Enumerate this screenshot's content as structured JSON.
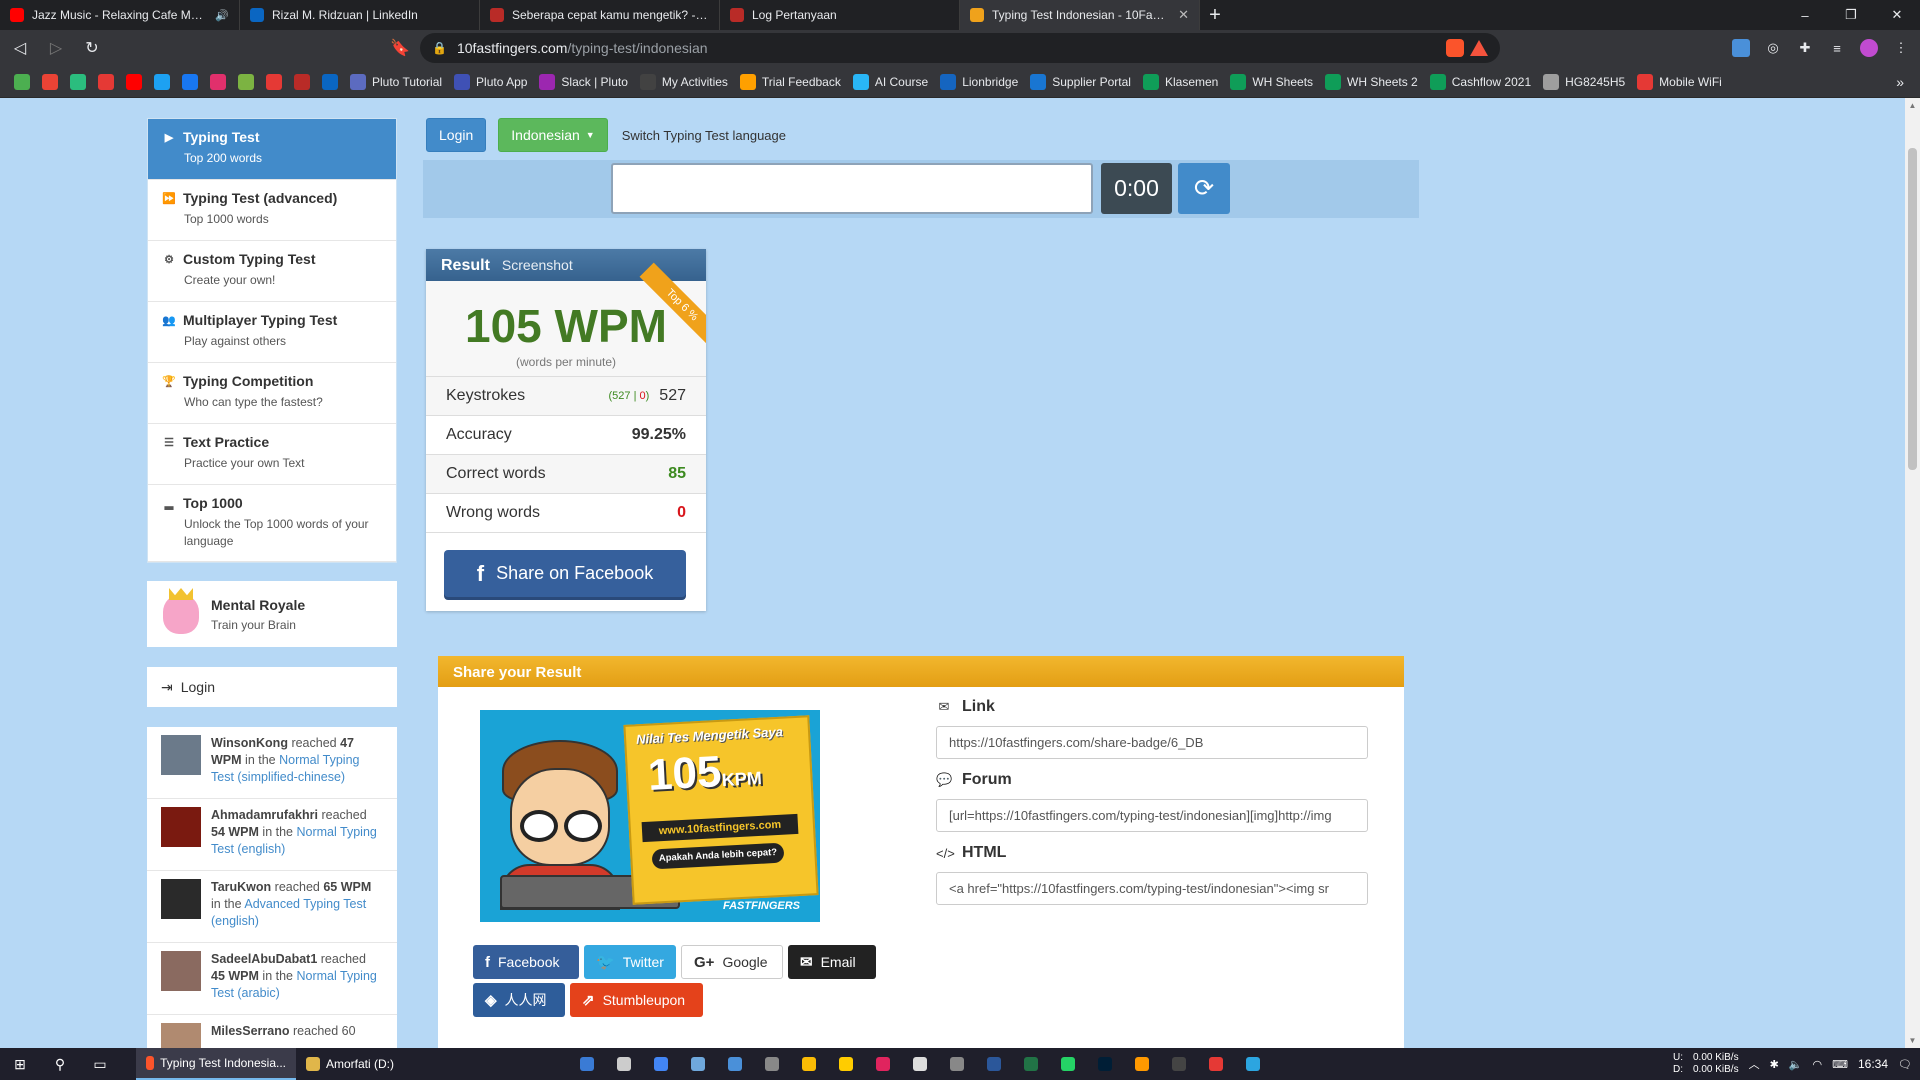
{
  "browser": {
    "tabs": [
      {
        "title": "Jazz Music - Relaxing Cafe Music -",
        "favicon_color": "#ff0000",
        "audio_icon": "speaker-icon"
      },
      {
        "title": "Rizal M. Ridzuan | LinkedIn",
        "favicon_color": "#0a66c2"
      },
      {
        "title": "Seberapa cepat kamu mengetik? - Qu",
        "favicon_color": "#b92b27"
      },
      {
        "title": "Log Pertanyaan",
        "favicon_color": "#b92b27"
      },
      {
        "title": "Typing Test Indonesian - 10FastFin",
        "favicon_color": "#f0a21b",
        "active": true
      }
    ],
    "url_host": "10fastfingers.com",
    "url_path": "/typing-test/indonesian",
    "bookmarks": [
      {
        "label": "",
        "color": "#4caf50"
      },
      {
        "label": "",
        "color": "#ea4335"
      },
      {
        "label": "",
        "color": "#2bbd7e"
      },
      {
        "label": "",
        "color": "#e53935"
      },
      {
        "label": "",
        "color": "#ff0000"
      },
      {
        "label": "",
        "color": "#1da1f2"
      },
      {
        "label": "",
        "color": "#1877f2"
      },
      {
        "label": "",
        "color": "#e1306c"
      },
      {
        "label": "",
        "color": "#7cb342"
      },
      {
        "label": "",
        "color": "#e53935"
      },
      {
        "label": "",
        "color": "#b92b27"
      },
      {
        "label": "",
        "color": "#0a66c2"
      },
      {
        "label": "Pluto Tutorial",
        "color": "#5c6bc0"
      },
      {
        "label": "Pluto App",
        "color": "#3f51b5"
      },
      {
        "label": "Slack | Pluto",
        "color": "#9c27b0"
      },
      {
        "label": "My Activities",
        "color": "#424242"
      },
      {
        "label": "Trial Feedback",
        "color": "#ffa000"
      },
      {
        "label": "AI Course",
        "color": "#29b6f6"
      },
      {
        "label": "Lionbridge",
        "color": "#1565c0"
      },
      {
        "label": "Supplier Portal",
        "color": "#1976d2"
      },
      {
        "label": "Klasemen",
        "color": "#0f9d58"
      },
      {
        "label": "WH Sheets",
        "color": "#0f9d58"
      },
      {
        "label": "WH Sheets 2",
        "color": "#0f9d58"
      },
      {
        "label": "Cashflow 2021",
        "color": "#0f9d58"
      },
      {
        "label": "HG8245H5",
        "color": "#9e9e9e"
      },
      {
        "label": "Mobile WiFi",
        "color": "#e53935"
      }
    ]
  },
  "sidebar": {
    "items": [
      {
        "title": "Typing Test",
        "sub": "Top 200 words",
        "icon": "play-icon",
        "glyph": "▶"
      },
      {
        "title": "Typing Test (advanced)",
        "sub": "Top 1000 words",
        "icon": "fast-forward-icon",
        "glyph": "⏩"
      },
      {
        "title": "Custom Typing Test",
        "sub": "Create your own!",
        "icon": "cogs-icon",
        "glyph": "⚙"
      },
      {
        "title": "Multiplayer Typing Test",
        "sub": "Play against others",
        "icon": "users-icon",
        "glyph": "👥"
      },
      {
        "title": "Typing Competition",
        "sub": "Who can type the fastest?",
        "icon": "trophy-icon",
        "glyph": "🏆"
      },
      {
        "title": "Text Practice",
        "sub": "Practice your own Text",
        "icon": "file-text-icon",
        "glyph": "☰"
      },
      {
        "title": "Top 1000",
        "sub": "Unlock the Top 1000 words of your language",
        "icon": "signal-icon",
        "glyph": "▂"
      }
    ],
    "royale": {
      "title": "Mental Royale",
      "sub": "Train your Brain"
    },
    "login": "Login",
    "feed": [
      {
        "user": "WinsonKong",
        "reached": "reached",
        "wpm": "47 WPM",
        "in_the": "in the",
        "test": "Normal Typing Test (simplified-chinese)",
        "avatar_color": "#6b7a8a"
      },
      {
        "user": "Ahmadamrufakhri",
        "reached": "reached",
        "wpm": "54 WPM",
        "in_the": "in the",
        "test": "Normal Typing Test (english)",
        "avatar_color": "#7a1a10"
      },
      {
        "user": "TaruKwon",
        "reached": "reached",
        "wpm": "65 WPM",
        "in_the": "in the",
        "test": "Advanced Typing Test (english)",
        "avatar_color": "#2a2a2a"
      },
      {
        "user": "SadeelAbuDabat1",
        "reached": "reached",
        "wpm": "45 WPM",
        "in_the": "in the",
        "test": "Normal Typing Test (arabic)",
        "avatar_color": "#8a6a60"
      },
      {
        "user": "MilesSerrano",
        "reached": "reached 60",
        "wpm": "",
        "in_the": "",
        "test": "",
        "avatar_color": "#b08a70"
      }
    ]
  },
  "top": {
    "login": "Login",
    "language": "Indonesian",
    "language_hint": "Switch Typing Test language"
  },
  "typebar": {
    "timer": "0:00",
    "input_value": ""
  },
  "result": {
    "title": "Result",
    "screenshot": "Screenshot",
    "ribbon": "Top 6 %",
    "wpm": "105 WPM",
    "wpm_sub": "(words per minute)",
    "keystrokes_label": "Keystrokes",
    "keystrokes_correct": "527",
    "keystrokes_wrong": "0",
    "keystrokes_total": "527",
    "accuracy_label": "Accuracy",
    "accuracy": "99.25%",
    "correct_label": "Correct words",
    "correct": "85",
    "wrong_label": "Wrong words",
    "wrong": "0",
    "facebook": "Share on Facebook"
  },
  "share": {
    "title": "Share your Result",
    "badge": {
      "title": "Nilai Tes Mengetik Saya",
      "number": "105",
      "unit": "KPM",
      "url": "www.10fastfingers.com",
      "ask": "Apakah Anda lebih cepat?",
      "logo": "FASTFINGERS"
    },
    "buttons": {
      "facebook": "Facebook",
      "twitter": "Twitter",
      "google": "Google",
      "email": "Email",
      "renren": "人人网",
      "stumbleupon": "Stumbleupon"
    },
    "link_label": "Link",
    "link_value": "https://10fastfingers.com/share-badge/6_DB",
    "forum_label": "Forum",
    "forum_value": "[url=https://10fastfingers.com/typing-test/indonesian][img]http://img",
    "html_label": "HTML",
    "html_value": "<a href=\"https://10fastfingers.com/typing-test/indonesian\"><img sr"
  },
  "taskbar": {
    "tasks": [
      {
        "label": "Typing Test Indonesia...",
        "active": true
      },
      {
        "label": "Amorfati (D:)",
        "active": false
      }
    ],
    "apps": [
      "#3a7bd5",
      "#cccccc",
      "#4285f4",
      "#6fa8dc",
      "#4a90d9",
      "#888888",
      "#fbbc05",
      "#ffcc00",
      "#e0245e",
      "#dddddd",
      "#888888",
      "#2b579a",
      "#217346",
      "#25d366",
      "#001e36",
      "#ff9900",
      "#444444",
      "#e53935",
      "#2ca5e0"
    ],
    "drives": "U:\nD:",
    "net_up": "0.00 KiB/s",
    "net_down": "0.00 KiB/s",
    "clock": "16:34"
  }
}
